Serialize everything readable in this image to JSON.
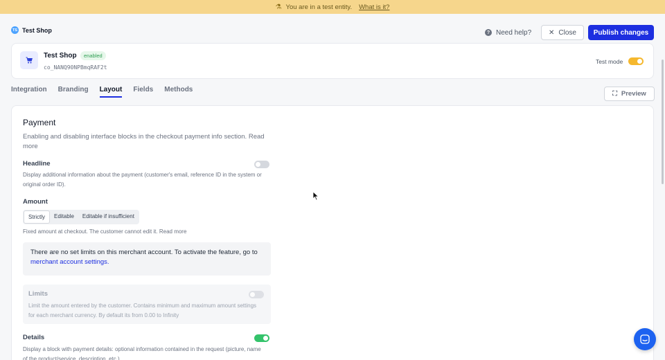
{
  "banner": {
    "text": "You are in a test entity.",
    "link": "What is it?"
  },
  "header": {
    "shop_initials": "TS",
    "shop_name": "Test Shop",
    "help": "Need help?",
    "close": "Close",
    "publish": "Publish changes"
  },
  "shop_card": {
    "name": "Test Shop",
    "status": "enabled",
    "id": "co_NANQ90NPBmqRAF2t",
    "test_mode_label": "Test mode",
    "test_mode_on": true
  },
  "tabs": [
    {
      "label": "Integration",
      "active": false
    },
    {
      "label": "Branding",
      "active": false
    },
    {
      "label": "Layout",
      "active": true
    },
    {
      "label": "Fields",
      "active": false
    },
    {
      "label": "Methods",
      "active": false
    }
  ],
  "preview": "Preview",
  "payment": {
    "title": "Payment",
    "description": "Enabling and disabling interface blocks in the checkout payment info section. Read more",
    "headline": {
      "title": "Headline",
      "description": "Display additional information about the payment (customer's email, reference ID in the system or original order ID).",
      "enabled": false
    },
    "amount": {
      "title": "Amount",
      "options": [
        "Strictly",
        "Editable",
        "Editable if insufficient"
      ],
      "selected": "Strictly",
      "description": "Fixed amount at checkout. The customer cannot edit it. Read more",
      "notice_text": "There are no set limits on this merchant account. To activate the feature, go to",
      "notice_link": "merchant account settings."
    },
    "limits": {
      "title": "Limits",
      "description": "Limit the amount entered by the customer. Contains minimum and maximum amount settings for each merchant currency. By default its from 0.00 to Infinity",
      "enabled": false
    },
    "details": {
      "title": "Details",
      "description": "Display a block with payment details: optional information contained in the request (picture, name of the product/service, description, etc.)",
      "enabled": true
    }
  },
  "colors": {
    "accent": "#1d2fe0",
    "banner": "#f6d68c",
    "toggle_yellow": "#f5b82e",
    "toggle_green": "#34c36b",
    "chat": "#1d62f0"
  }
}
